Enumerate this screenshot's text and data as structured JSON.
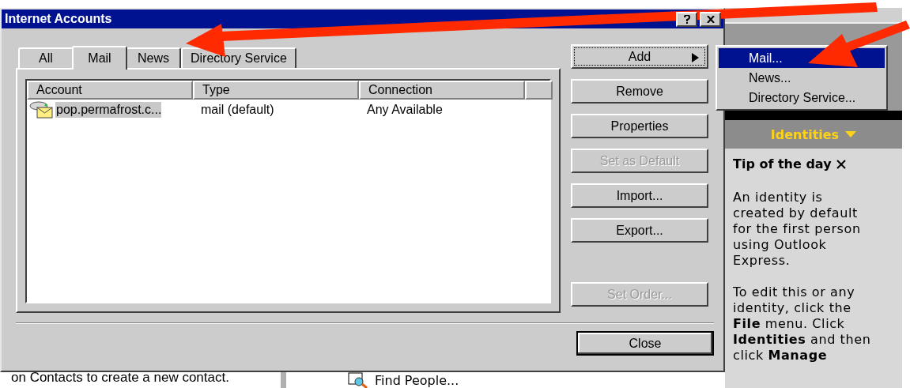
{
  "window": {
    "title": "Internet Accounts"
  },
  "tabs": [
    {
      "label": "All",
      "selected": false
    },
    {
      "label": "Mail",
      "selected": true
    },
    {
      "label": "News",
      "selected": false
    },
    {
      "label": "Directory Service",
      "selected": false
    }
  ],
  "table": {
    "columns": [
      "Account",
      "Type",
      "Connection"
    ],
    "rows": [
      {
        "cells": [
          "pop.permafrost.c...",
          "mail (default)",
          "Any Available"
        ],
        "selected": true
      }
    ]
  },
  "action_buttons": [
    {
      "label": "Add",
      "kind": "submenu",
      "disabled": false,
      "focused": true
    },
    {
      "label": "Remove",
      "kind": "plain",
      "disabled": false,
      "focused": false
    },
    {
      "label": "Properties",
      "kind": "plain",
      "disabled": false,
      "focused": false
    },
    {
      "label": "Set as Default",
      "kind": "plain",
      "disabled": true,
      "focused": false
    },
    {
      "label": "Import...",
      "kind": "plain",
      "disabled": false,
      "focused": false
    },
    {
      "label": "Export...",
      "kind": "plain",
      "disabled": false,
      "focused": false
    }
  ],
  "order_buttons": [
    {
      "label": "Set Order...",
      "kind": "plain",
      "disabled": true,
      "focused": false
    }
  ],
  "close_button": {
    "label": "Close"
  },
  "add_menu": [
    {
      "label": "Mail...",
      "selected": true
    },
    {
      "label": "News...",
      "selected": false
    },
    {
      "label": "Directory Service...",
      "selected": false
    }
  ],
  "identities_panel": {
    "header": "Identities",
    "tip_title": "Tip of the day",
    "paragraphs": [
      "An identity is created by default for the first person using Outlook Express.",
      "To edit this or any identity, click the **File** menu. Click **Identities** and then click **Manage**"
    ]
  },
  "background": {
    "contacts_text": "on Contacts to create a new contact.",
    "find_people": "Find People..."
  }
}
